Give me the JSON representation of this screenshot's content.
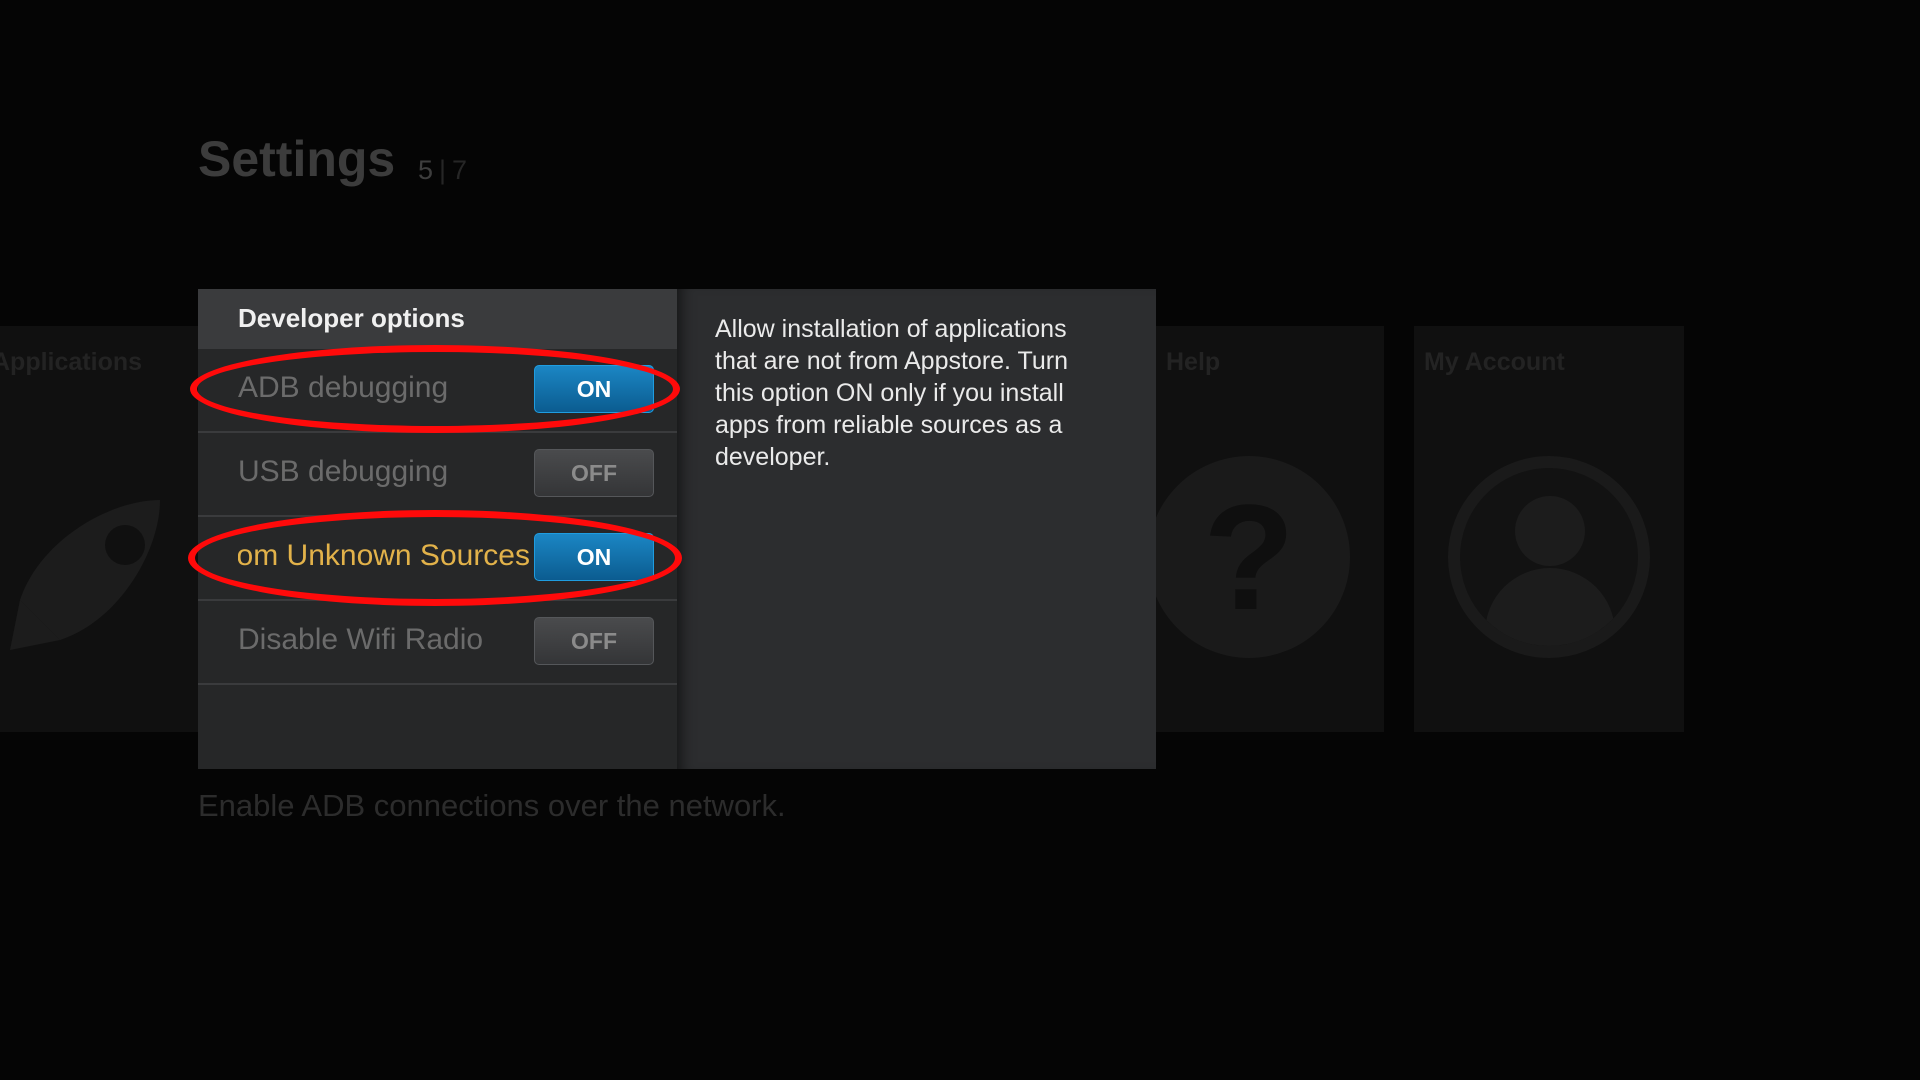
{
  "background": {
    "title": "Settings",
    "pager": {
      "current": "5",
      "separator": "|",
      "total": "7"
    },
    "tiles": [
      {
        "label": "Applications",
        "icon": "rocket-icon"
      },
      {
        "label": "Help",
        "icon": "help-icon"
      },
      {
        "label": "My Account",
        "icon": "account-icon"
      }
    ],
    "caption": "Enable ADB connections over the network."
  },
  "dialog": {
    "header": "Developer options",
    "options": [
      {
        "label": "ADB debugging",
        "state": "ON"
      },
      {
        "label": "USB debugging",
        "state": "OFF"
      },
      {
        "label": "Apps from Unknown Sources",
        "state": "ON"
      },
      {
        "label": "Disable Wifi Radio",
        "state": "OFF"
      }
    ],
    "description": "Allow installation of applications that are not from Appstore. Turn this option ON only if you install apps from reliable sources as a developer."
  },
  "colors": {
    "toggle_on": "#1b86c4",
    "focused_label": "#e2b24a",
    "highlight": "#ff0a0a"
  }
}
